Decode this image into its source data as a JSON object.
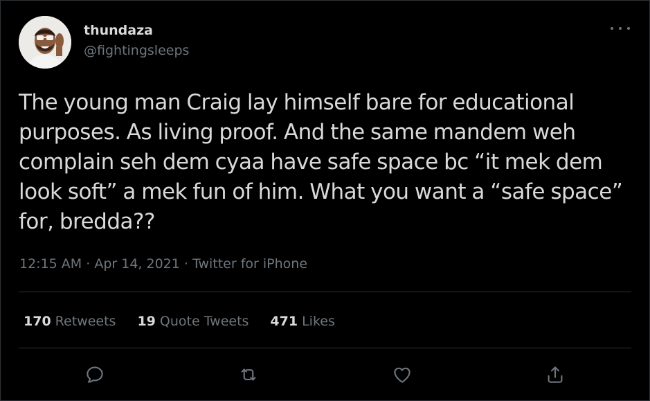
{
  "author": {
    "display_name": "thundaza",
    "handle": "@fightingsleeps",
    "avatar_icon": "avatar-photo"
  },
  "tweet": {
    "text": "The young man Craig lay himself bare for educational purposes. As living proof. And the same mandem weh complain seh dem cyaa have safe space bc “it mek dem look soft” a mek fun of him. What you want a “safe space” for, bredda??",
    "time": "12:15 AM",
    "date": "Apr 14, 2021",
    "source": "Twitter for iPhone",
    "separator": "·"
  },
  "stats": {
    "retweets": {
      "count": "170",
      "label": "Retweets"
    },
    "quote_tweets": {
      "count": "19",
      "label": "Quote Tweets"
    },
    "likes": {
      "count": "471",
      "label": "Likes"
    }
  },
  "icons": {
    "more": "more-icon",
    "reply": "reply-icon",
    "retweet": "retweet-icon",
    "like": "like-icon",
    "share": "share-icon"
  },
  "colors": {
    "background": "#000000",
    "text": "#d9d9d9",
    "muted": "#6e767d",
    "border": "#2f3336"
  }
}
